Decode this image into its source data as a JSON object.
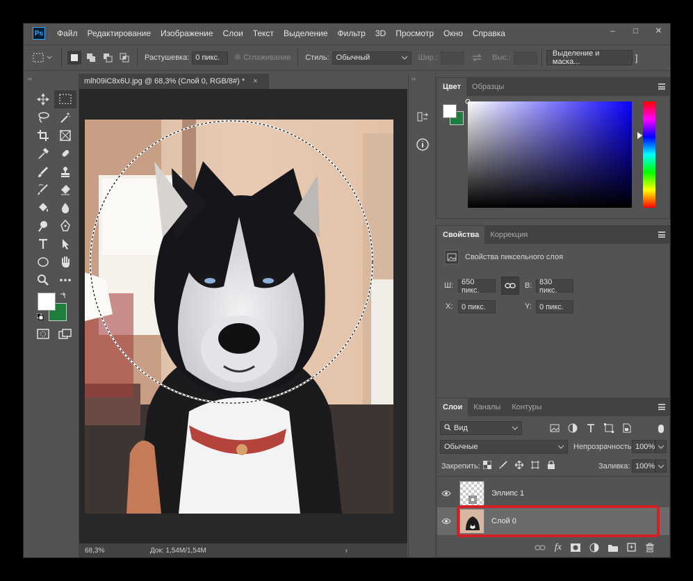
{
  "menu": {
    "items": [
      "Файл",
      "Редактирование",
      "Изображение",
      "Слои",
      "Текст",
      "Выделение",
      "Фильтр",
      "3D",
      "Просмотр",
      "Окно",
      "Справка"
    ],
    "logo": "Ps"
  },
  "window_controls": {
    "minimize": "–",
    "maximize": "□",
    "close": "✕"
  },
  "options": {
    "feather_label": "Растушевка:",
    "feather_value": "0 пикс.",
    "antialias_label": "Сглаживание",
    "style_label": "Стиль:",
    "style_value": "Обычный",
    "width_label": "Шир.:",
    "height_label": "Выс.:",
    "select_mask_button": "Выделение и маска..."
  },
  "document": {
    "tab_title": "mlh09iC8x6U.jpg @ 68,3% (Слой 0, RGB/8#) *",
    "tab_close": "×",
    "zoom": "68,3%",
    "doc_info": "Док: 1,54M/1,54M",
    "status_arrow": "›"
  },
  "color_panel": {
    "tabs": [
      "Цвет",
      "Образцы"
    ],
    "foreground": "#ffffff",
    "background": "#1e7e3e",
    "hue_pointer": "blue"
  },
  "properties_panel": {
    "tabs": [
      "Свойства",
      "Коррекция"
    ],
    "title": "Свойства пиксельного слоя",
    "w_label": "Ш:",
    "w_value": "650 пикс.",
    "h_label": "В:",
    "h_value": "830 пикс.",
    "x_label": "X:",
    "x_value": "0 пикс.",
    "y_label": "Y:",
    "y_value": "0 пикс."
  },
  "layers_panel": {
    "tabs": [
      "Слои",
      "Каналы",
      "Контуры"
    ],
    "filter_value": "Вид",
    "blend_mode": "Обычные",
    "opacity_label": "Непрозрачность:",
    "opacity_value": "100%",
    "lock_label": "Закрепить:",
    "fill_label": "Заливка:",
    "fill_value": "100%",
    "layers": [
      {
        "name": "Эллипс 1",
        "visible": true,
        "selected": false
      },
      {
        "name": "Слой 0",
        "visible": true,
        "selected": true
      }
    ],
    "highlight_color": "#d41f24"
  },
  "colors": {
    "accent": "#31a8ff",
    "ui_bg": "#535353",
    "ui_dark": "#424242",
    "canvas_bg": "#282828"
  }
}
